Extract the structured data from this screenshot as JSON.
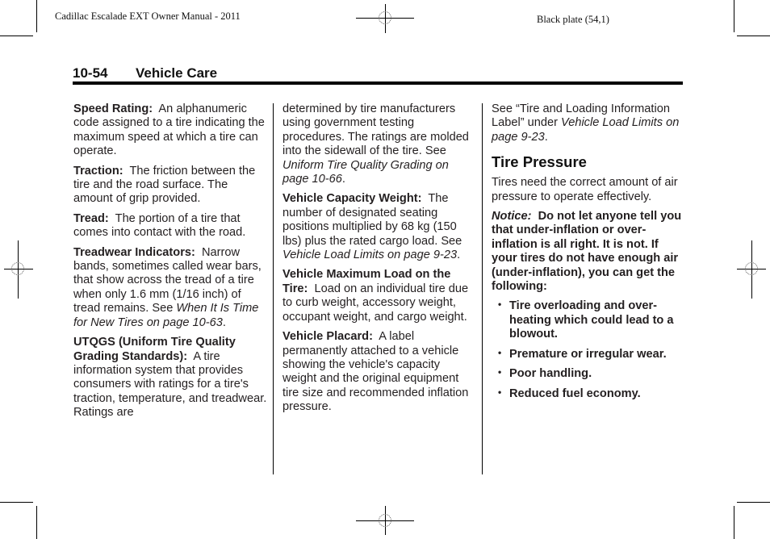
{
  "print_marks": {
    "left_header": "Cadillac Escalade EXT Owner Manual - 2011",
    "right_header": "Black plate (54,1)"
  },
  "page_header": {
    "page_number": "10-54",
    "section": "Vehicle Care"
  },
  "column1": {
    "speed_rating": {
      "term": "Speed Rating:",
      "text": "An alphanumeric code assigned to a tire indicating the maximum speed at which a tire can operate."
    },
    "traction": {
      "term": "Traction:",
      "text": "The friction between the tire and the road surface. The amount of grip provided."
    },
    "tread": {
      "term": "Tread:",
      "text": "The portion of a tire that comes into contact with the road."
    },
    "treadwear": {
      "term": "Treadwear Indicators:",
      "text": "Narrow bands, sometimes called wear bars, that show across the tread of a tire when only 1.6 mm (1/16 inch) of tread remains.",
      "see": "See",
      "link": "When It Is Time for New Tires on page 10-63",
      "end": "."
    },
    "utqgs": {
      "term": "UTQGS (Uniform Tire Quality Grading Standards):",
      "text": "A tire information system that provides consumers with ratings for a tire's traction, temperature, and treadwear. Ratings are"
    }
  },
  "column2": {
    "utqgs_cont": {
      "text": "determined by tire manufacturers using government testing procedures. The ratings are molded into the sidewall of the tire. See",
      "link": "Uniform Tire Quality Grading on page 10-66",
      "end": "."
    },
    "capacity_weight": {
      "term": "Vehicle Capacity Weight:",
      "text": "The number of designated seating positions multiplied by 68 kg (150 lbs) plus the rated cargo load. See",
      "link": "Vehicle Load Limits on page 9-23",
      "end": "."
    },
    "max_load": {
      "term": "Vehicle Maximum Load on the Tire:",
      "text": "Load on an individual tire due to curb weight, accessory weight, occupant weight, and cargo weight."
    },
    "placard": {
      "term": "Vehicle Placard:",
      "text": "A label permanently attached to a vehicle showing the vehicle's capacity weight and the original equipment tire size and recommended inflation pressure."
    }
  },
  "column3": {
    "see_label": {
      "text": "See “Tire and Loading Information Label” under",
      "link": "Vehicle Load Limits on page 9-23",
      "end": "."
    },
    "heading": "Tire Pressure",
    "intro": "Tires need the correct amount of air pressure to operate effectively.",
    "notice": {
      "label": "Notice:",
      "text": "Do not let anyone tell you that under-inflation or over-inflation is all right. It is not. If your tires do not have enough air (under-inflation), you can get the following:"
    },
    "bullets": [
      "Tire overloading and over-heating which could lead to a blowout.",
      "Premature or irregular wear.",
      "Poor handling.",
      "Reduced fuel economy."
    ]
  }
}
